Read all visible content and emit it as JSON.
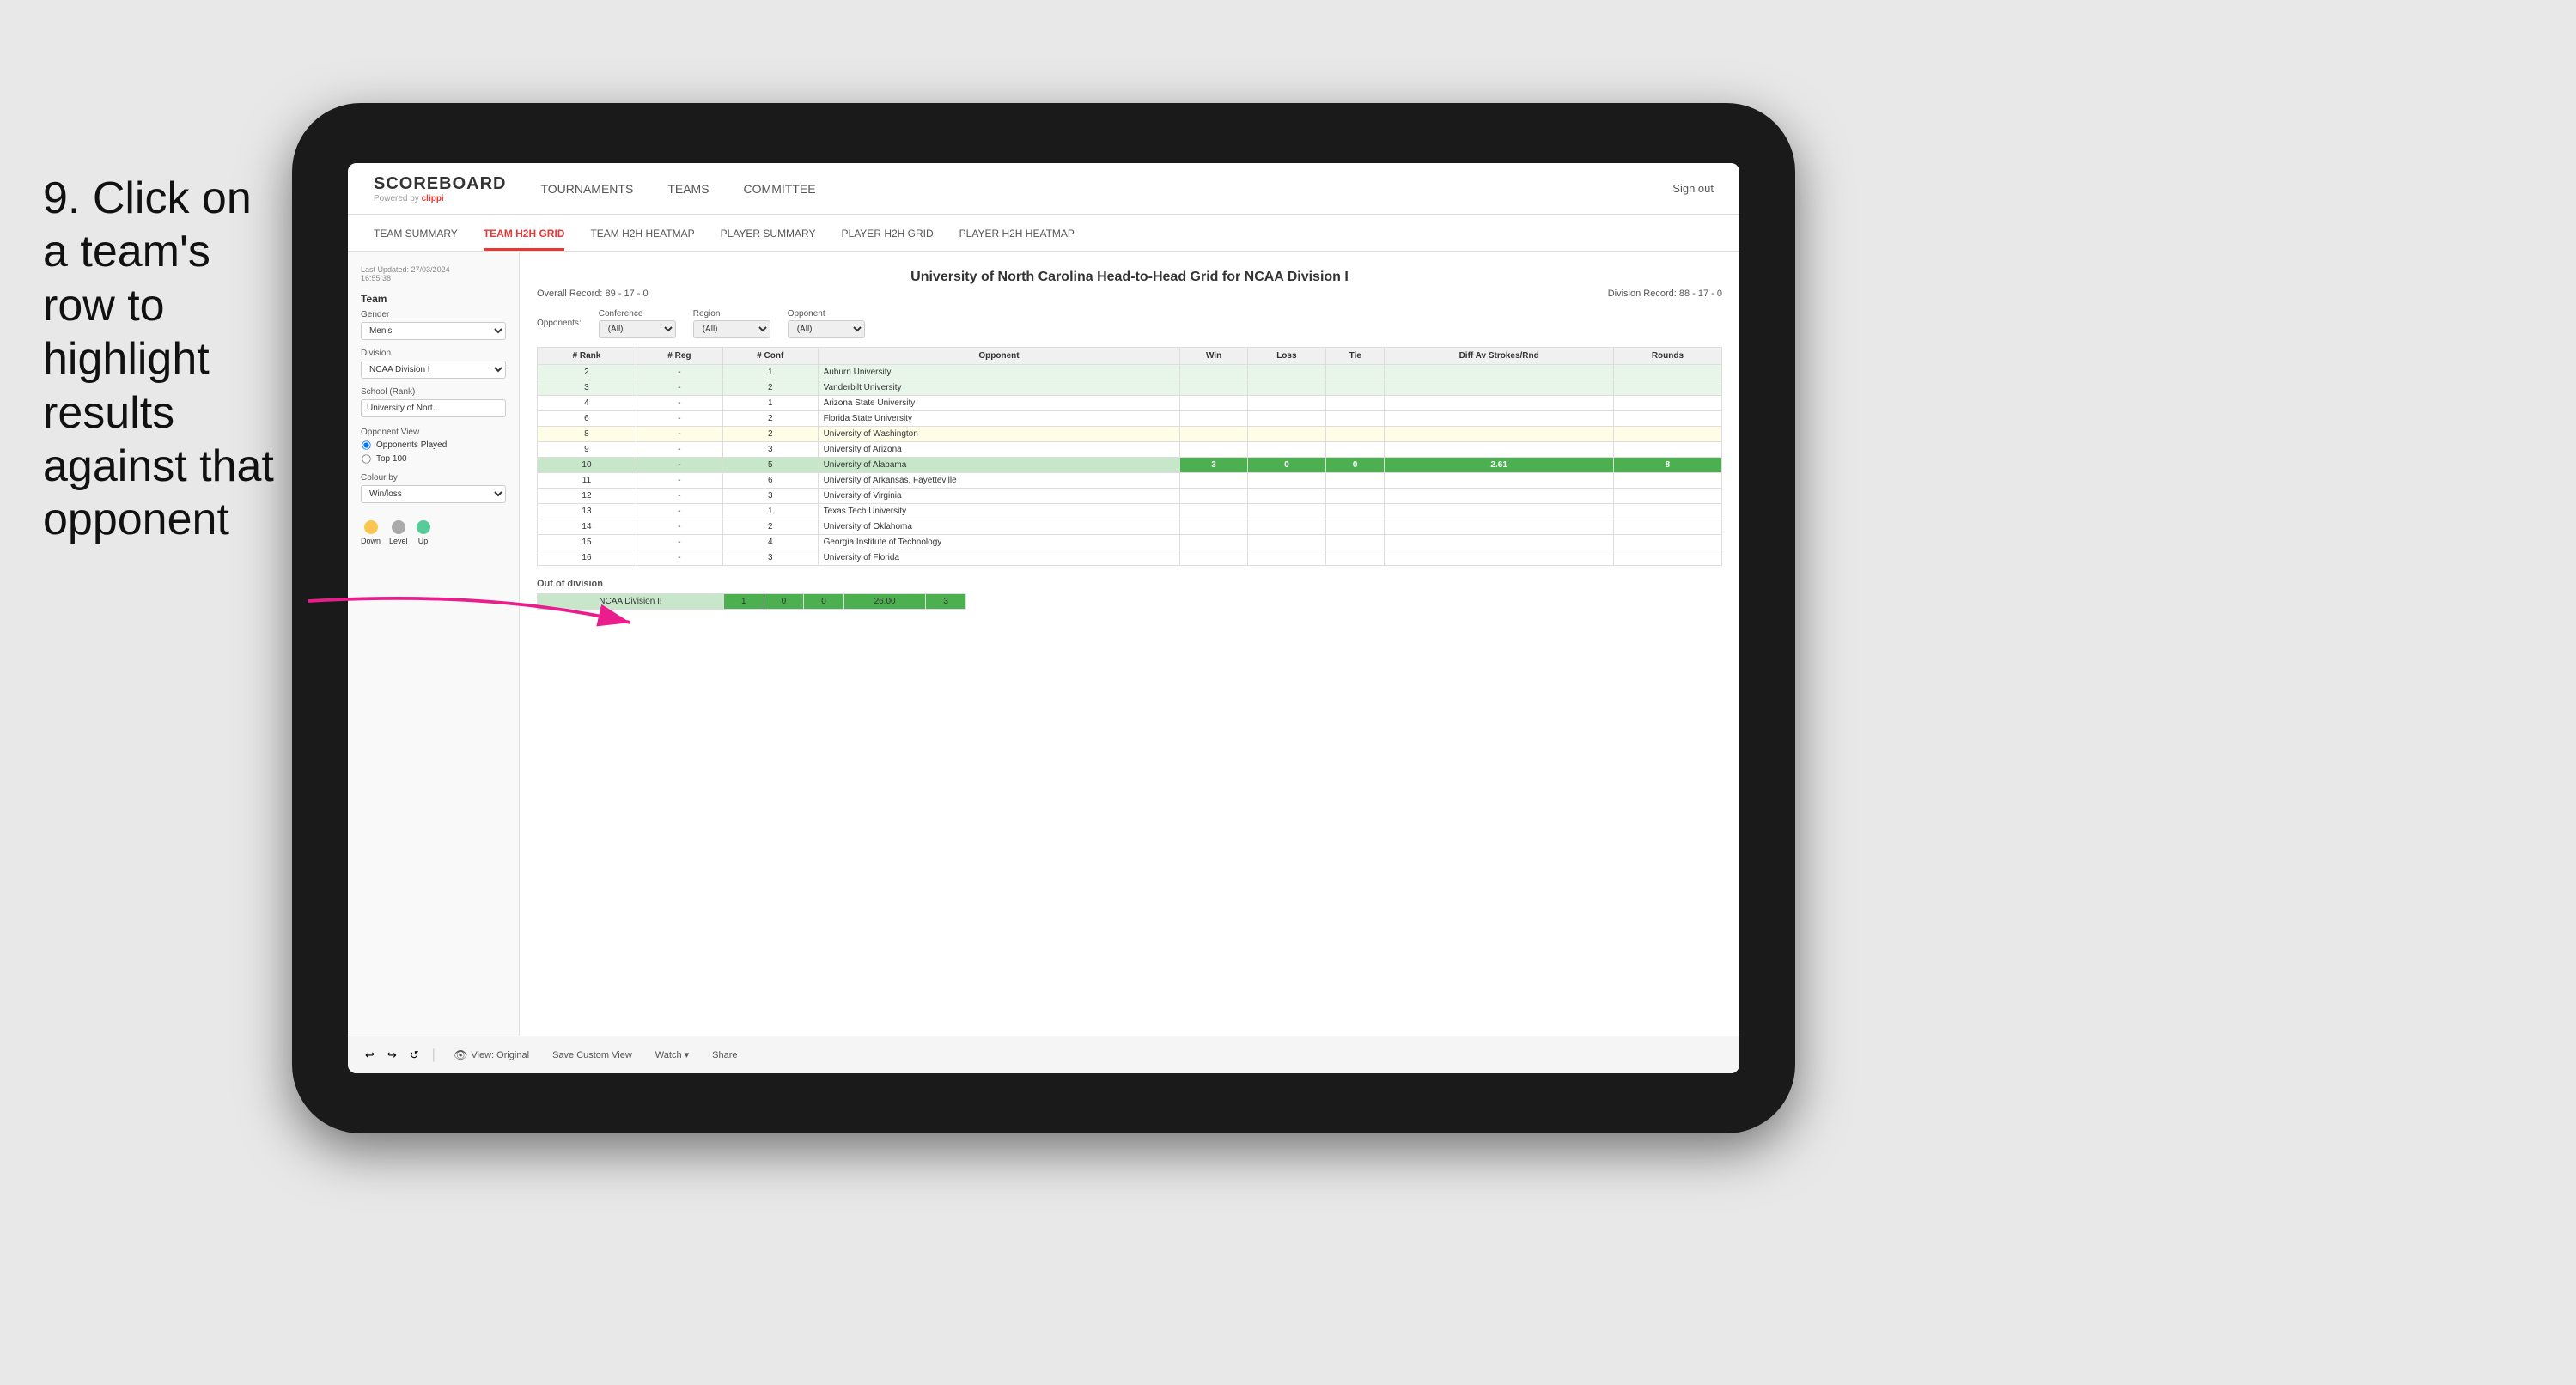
{
  "instruction": {
    "step": "9.",
    "text": "Click on a team's row to highlight results against that opponent"
  },
  "nav": {
    "logo": "SCOREBOARD",
    "powered_by": "Powered by",
    "brand": "clippi",
    "links": [
      "TOURNAMENTS",
      "TEAMS",
      "COMMITTEE"
    ],
    "sign_out": "Sign out"
  },
  "sub_nav": {
    "links": [
      "TEAM SUMMARY",
      "TEAM H2H GRID",
      "TEAM H2H HEATMAP",
      "PLAYER SUMMARY",
      "PLAYER H2H GRID",
      "PLAYER H2H HEATMAP"
    ],
    "active": "TEAM H2H GRID"
  },
  "sidebar": {
    "timestamp": "Last Updated: 27/03/2024",
    "time": "16:55:38",
    "team_label": "Team",
    "gender_label": "Gender",
    "gender_value": "Men's",
    "division_label": "Division",
    "division_value": "NCAA Division I",
    "school_label": "School (Rank)",
    "school_value": "University of Nort...",
    "opponent_view_label": "Opponent View",
    "opponent_options": [
      "Opponents Played",
      "Top 100"
    ],
    "opponent_selected": "Opponents Played",
    "colour_by_label": "Colour by",
    "colour_by_value": "Win/loss",
    "legend": [
      {
        "label": "Down",
        "color": "down"
      },
      {
        "label": "Level",
        "color": "level"
      },
      {
        "label": "Up",
        "color": "up"
      }
    ]
  },
  "grid": {
    "title": "University of North Carolina Head-to-Head Grid for NCAA Division I",
    "overall_record": "Overall Record: 89 - 17 - 0",
    "division_record": "Division Record: 88 - 17 - 0",
    "filters": {
      "conference_label": "Conference",
      "conference_value": "(All)",
      "region_label": "Region",
      "region_value": "(All)",
      "opponent_label": "Opponent",
      "opponent_value": "(All)",
      "opponents_label": "Opponents:"
    },
    "table_headers": [
      "# Rank",
      "# Reg",
      "# Conf",
      "Opponent",
      "Win",
      "Loss",
      "Tie",
      "Diff Av Strokes/Rnd",
      "Rounds"
    ],
    "rows": [
      {
        "rank": "2",
        "reg": "-",
        "conf": "1",
        "opponent": "Auburn University",
        "win": "",
        "loss": "",
        "tie": "",
        "diff": "",
        "rounds": "",
        "highlight": false,
        "color": "light-green"
      },
      {
        "rank": "3",
        "reg": "-",
        "conf": "2",
        "opponent": "Vanderbilt University",
        "win": "",
        "loss": "",
        "tie": "",
        "diff": "",
        "rounds": "",
        "highlight": false,
        "color": "light-green"
      },
      {
        "rank": "4",
        "reg": "-",
        "conf": "1",
        "opponent": "Arizona State University",
        "win": "",
        "loss": "",
        "tie": "",
        "diff": "",
        "rounds": "",
        "highlight": false,
        "color": "none"
      },
      {
        "rank": "6",
        "reg": "-",
        "conf": "2",
        "opponent": "Florida State University",
        "win": "",
        "loss": "",
        "tie": "",
        "diff": "",
        "rounds": "",
        "highlight": false,
        "color": "none"
      },
      {
        "rank": "8",
        "reg": "-",
        "conf": "2",
        "opponent": "University of Washington",
        "win": "",
        "loss": "",
        "tie": "",
        "diff": "",
        "rounds": "",
        "highlight": false,
        "color": "light-yellow"
      },
      {
        "rank": "9",
        "reg": "-",
        "conf": "3",
        "opponent": "University of Arizona",
        "win": "",
        "loss": "",
        "tie": "",
        "diff": "",
        "rounds": "",
        "highlight": false,
        "color": "none"
      },
      {
        "rank": "10",
        "reg": "-",
        "conf": "5",
        "opponent": "University of Alabama",
        "win": "3",
        "loss": "0",
        "tie": "0",
        "diff": "2.61",
        "rounds": "8",
        "highlight": true,
        "color": "green-highlight"
      },
      {
        "rank": "11",
        "reg": "-",
        "conf": "6",
        "opponent": "University of Arkansas, Fayetteville",
        "win": "",
        "loss": "",
        "tie": "",
        "diff": "",
        "rounds": "",
        "highlight": false,
        "color": "none"
      },
      {
        "rank": "12",
        "reg": "-",
        "conf": "3",
        "opponent": "University of Virginia",
        "win": "",
        "loss": "",
        "tie": "",
        "diff": "",
        "rounds": "",
        "highlight": false,
        "color": "none"
      },
      {
        "rank": "13",
        "reg": "-",
        "conf": "1",
        "opponent": "Texas Tech University",
        "win": "",
        "loss": "",
        "tie": "",
        "diff": "",
        "rounds": "",
        "highlight": false,
        "color": "none"
      },
      {
        "rank": "14",
        "reg": "-",
        "conf": "2",
        "opponent": "University of Oklahoma",
        "win": "",
        "loss": "",
        "tie": "",
        "diff": "",
        "rounds": "",
        "highlight": false,
        "color": "none"
      },
      {
        "rank": "15",
        "reg": "-",
        "conf": "4",
        "opponent": "Georgia Institute of Technology",
        "win": "",
        "loss": "",
        "tie": "",
        "diff": "",
        "rounds": "",
        "highlight": false,
        "color": "none"
      },
      {
        "rank": "16",
        "reg": "-",
        "conf": "3",
        "opponent": "University of Florida",
        "win": "",
        "loss": "",
        "tie": "",
        "diff": "",
        "rounds": "",
        "highlight": false,
        "color": "none"
      }
    ],
    "out_of_division_label": "Out of division",
    "out_of_division_row": {
      "name": "NCAA Division II",
      "win": "1",
      "loss": "0",
      "tie": "0",
      "diff": "26.00",
      "rounds": "3"
    }
  },
  "toolbar": {
    "buttons": [
      "View: Original",
      "Save Custom View",
      "Watch ▾",
      "Share"
    ]
  }
}
